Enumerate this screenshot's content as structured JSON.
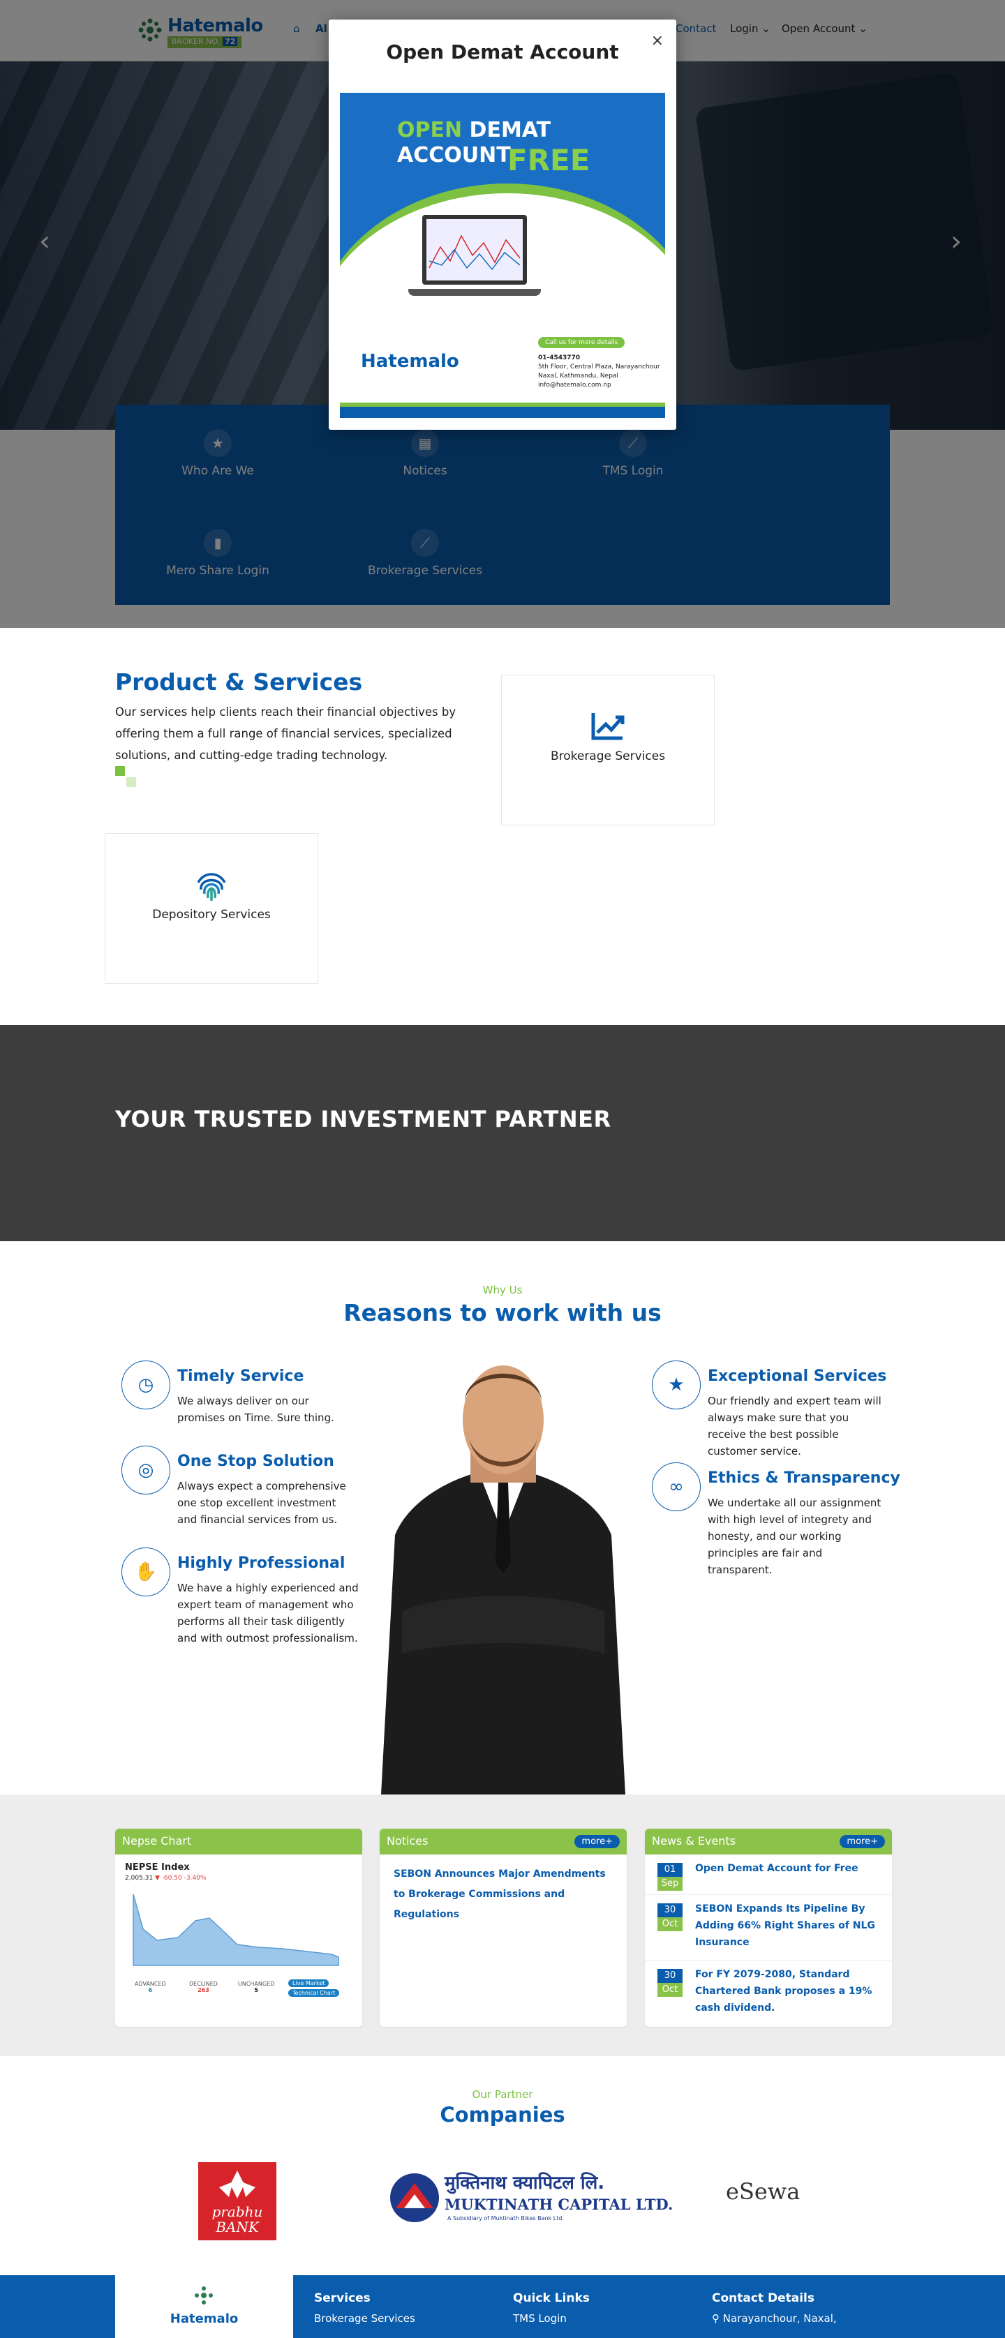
{
  "header": {
    "logo_name": "Hatemalo",
    "logo_badge": "BROKER NO.",
    "logo_badge_number": "72",
    "nav": {
      "home_partial": "Al",
      "contact": "Contact",
      "login": "Login",
      "open_account": "Open Account"
    }
  },
  "modal": {
    "title": "Open Demat Account",
    "close": "×",
    "promo": {
      "line1a": "OPEN",
      "line1b": "DEMAT",
      "line2": "ACCOUNT",
      "line3": "FREE",
      "logo": "Hatemalo",
      "call": "Call us for more details",
      "phone": "01-4543770",
      "address1": "5th Floor, Central Plaza, Narayanchour",
      "address2": "Naxal, Kathmandu, Nepal",
      "email": "info@hatemalo.com.np"
    }
  },
  "hero": {
    "prev": "‹",
    "next": "›"
  },
  "quick_links": [
    {
      "label": "Who Are We",
      "icon": "star-icon",
      "glyph": "★"
    },
    {
      "label": "Notices",
      "icon": "calendar-icon",
      "glyph": "▦"
    },
    {
      "label": "TMS Login",
      "icon": "line-chart-icon",
      "glyph": "⟋"
    },
    {
      "label": "Mero Share Login",
      "icon": "bar-chart-icon",
      "glyph": "▮"
    },
    {
      "label": "Brokerage Services",
      "icon": "trend-icon",
      "glyph": "⟋"
    }
  ],
  "product_services": {
    "title": "Product & Services",
    "text": "Our services help clients reach their financial objectives by offering them a full range of financial services, specialized solutions, and cutting-edge trading technology.",
    "cards": [
      {
        "label": "Brokerage Services",
        "icon": "trend-up-icon"
      },
      {
        "label": "Depository Services",
        "icon": "fingerprint-icon"
      }
    ]
  },
  "band": {
    "title": "YOUR TRUSTED INVESTMENT PARTNER"
  },
  "why": {
    "subtitle": "Why Us",
    "title": "Reasons to work with us",
    "reasons": [
      {
        "title": "Timely Service",
        "text": "We always deliver on our promises on Time. Sure thing.",
        "icon": "clock-icon",
        "glyph": "◷"
      },
      {
        "title": "One Stop Solution",
        "text": "Always expect a comprehensive one stop excellent investment and financial services from us.",
        "icon": "target-icon",
        "glyph": "◎"
      },
      {
        "title": "Highly Professional",
        "text": "We have a highly experienced and expert team of management who performs all their task diligently and with outmost professionalism.",
        "icon": "handshake-icon",
        "glyph": "✋"
      },
      {
        "title": "Exceptional Services",
        "text": "Our friendly and expert team will always make sure that you receive the best possible customer service.",
        "icon": "star-icon",
        "glyph": "★"
      },
      {
        "title": "Ethics & Transparency",
        "text": "We undertake all our assignment with high level of integrety and honesty, and our working principles are fair and transparent.",
        "icon": "glasses-icon",
        "glyph": "∞"
      }
    ]
  },
  "widgets": {
    "chart_title": "Nepse Chart",
    "chart": {
      "index_label": "NEPSE Index",
      "index_value": "2,005.31",
      "index_change": "-60.50",
      "index_pct": "-3.40%",
      "stats": [
        {
          "label": "ADVANCED",
          "value": "6"
        },
        {
          "label": "DECLINED",
          "value": "263"
        },
        {
          "label": "UNCHANGED",
          "value": "5"
        }
      ],
      "btn1": "Live Market",
      "btn2": "Technical Chart"
    },
    "notices_title": "Notices",
    "notices_more": "more+",
    "notice_text": "SEBON Announces Major Amendments to Brokerage Commissions and Regulations",
    "news_title": "News & Events",
    "news_more": "more+",
    "news": [
      {
        "day": "01",
        "month": "Sep",
        "text": "Open Demat Account for Free"
      },
      {
        "day": "30",
        "month": "Oct",
        "text": "SEBON Expands Its Pipeline By Adding 66% Right Shares of NLG Insurance"
      },
      {
        "day": "30",
        "month": "Oct",
        "text": "For FY 2079-2080, Standard Chartered Bank proposes a 19% cash dividend."
      }
    ]
  },
  "partners": {
    "subtitle": "Our Partner",
    "title": "Companies",
    "prabhu": "prabhu BANK",
    "muktinath_np": "मुक्तिनाथ क्यापिटल लि.",
    "muktinath_en": "MUKTINATH CAPITAL LTD.",
    "muktinath_sub": "A Subsidiary of Muktinath Bikas Bank Ltd.",
    "esewa": "eSewa"
  },
  "footer": {
    "logo": "Hatemalo",
    "services_title": "Services",
    "services_item": "Brokerage Services",
    "quick_title": "Quick Links",
    "quick_item": "TMS Login",
    "contact_title": "Contact Details",
    "contact_item": "Narayanchour, Naxal,"
  }
}
